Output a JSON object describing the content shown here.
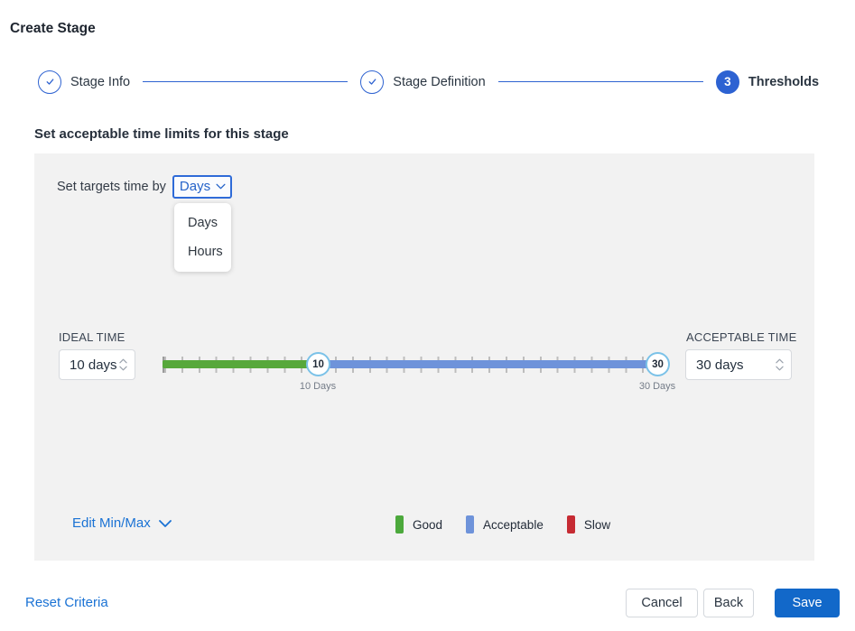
{
  "window": {
    "title": "Create Stage"
  },
  "stepper": {
    "steps": [
      {
        "label": "Stage Info",
        "state": "complete"
      },
      {
        "label": "Stage Definition",
        "state": "complete"
      },
      {
        "label": "Thresholds",
        "state": "current",
        "number": "3"
      }
    ]
  },
  "thresholds": {
    "heading": "Set acceptable time limits for this stage",
    "targets_time_label": "Set targets time by",
    "unit_dropdown": {
      "selected": "Days",
      "options": [
        "Days",
        "Hours"
      ]
    },
    "ideal": {
      "label": "IDEAL TIME",
      "value": "10 days"
    },
    "acceptable": {
      "label": "ACCEPTABLE TIME",
      "value": "30 days"
    },
    "slider": {
      "min_value": "10",
      "max_value": "30",
      "min_caption": "10 Days",
      "max_caption": "30 Days"
    },
    "edit_minmax_label": "Edit Min/Max",
    "legend": [
      {
        "label": "Good",
        "color": "#4ca93c"
      },
      {
        "label": "Acceptable",
        "color": "#6e93da"
      },
      {
        "label": "Slow",
        "color": "#c62b33"
      }
    ]
  },
  "footer": {
    "reset_label": "Reset Criteria",
    "cancel_label": "Cancel",
    "back_label": "Back",
    "save_label": "Save"
  },
  "colors": {
    "accent_blue": "#2f63d1",
    "link_blue": "#1a72d4",
    "save_blue": "#1268c9",
    "track_green": "#57a83b",
    "track_blue": "#6e93da",
    "panel_gray": "#f2f2f2",
    "handle_border": "#7bc2e8"
  }
}
